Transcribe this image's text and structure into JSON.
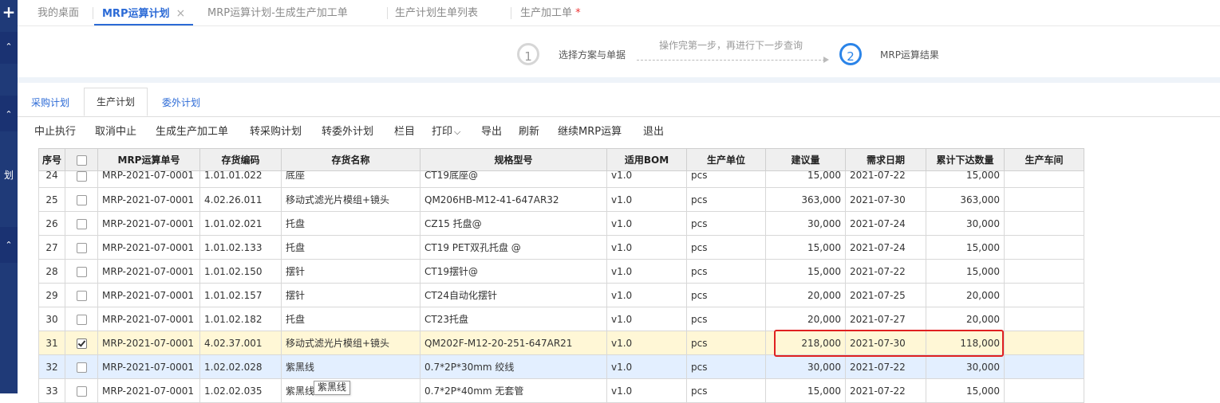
{
  "sidebar": {
    "label": "划"
  },
  "tabs": [
    {
      "label": "我的桌面",
      "active": false
    },
    {
      "label": "MRP运算计划",
      "active": true,
      "close": "×"
    },
    {
      "label": "MRP运算计划-生成生产加工单",
      "active": false
    },
    {
      "label": "生产计划生单列表",
      "active": false
    },
    {
      "label": "生产加工单",
      "active": false,
      "mark": "*"
    }
  ],
  "stepper": {
    "step1_num": "1",
    "step1_label": "选择方案与单据",
    "hint": "操作完第一步，再进行下一步查询",
    "step2_num": "2",
    "step2_label": "MRP运算结果"
  },
  "subtabs": [
    "采购计划",
    "生产计划",
    "委外计划"
  ],
  "toolbar": {
    "items": [
      "中止执行",
      "取消中止",
      "生成生产加工单",
      "转采购计划",
      "转委外计划",
      "栏目",
      "打印",
      "导出",
      "刷新",
      "继续MRP运算",
      "退出"
    ],
    "print_caret": "⌵"
  },
  "table": {
    "columns": [
      "序号",
      "",
      "MRP运算单号",
      "存货编码",
      "存货名称",
      "规格型号",
      "适用BOM",
      "生产单位",
      "建议量",
      "需求日期",
      "累计下达数量",
      "生产车间"
    ],
    "rows": [
      {
        "no": "24",
        "checked": false,
        "order": "MRP-2021-07-0001",
        "code": "1.01.01.022",
        "name": "底座",
        "spec": "CT19底座@",
        "bom": "v1.0",
        "unit": "pcs",
        "qty": "15,000",
        "date": "2021-07-22",
        "issued": "15,000",
        "workshop": ""
      },
      {
        "no": "25",
        "checked": false,
        "order": "MRP-2021-07-0001",
        "code": "4.02.26.011",
        "name": "移动式滤光片模组+镜头",
        "spec": "QM206HB-M12-41-647AR32",
        "bom": "v1.0",
        "unit": "pcs",
        "qty": "363,000",
        "date": "2021-07-30",
        "issued": "363,000",
        "workshop": ""
      },
      {
        "no": "26",
        "checked": false,
        "order": "MRP-2021-07-0001",
        "code": "1.01.02.021",
        "name": "托盘",
        "spec": "CZ15 托盘@",
        "bom": "v1.0",
        "unit": "pcs",
        "qty": "30,000",
        "date": "2021-07-24",
        "issued": "30,000",
        "workshop": ""
      },
      {
        "no": "27",
        "checked": false,
        "order": "MRP-2021-07-0001",
        "code": "1.01.02.133",
        "name": "托盘",
        "spec": "CT19 PET双孔托盘 @",
        "bom": "v1.0",
        "unit": "pcs",
        "qty": "15,000",
        "date": "2021-07-24",
        "issued": "15,000",
        "workshop": ""
      },
      {
        "no": "28",
        "checked": false,
        "order": "MRP-2021-07-0001",
        "code": "1.01.02.150",
        "name": "摆针",
        "spec": "CT19摆针@",
        "bom": "v1.0",
        "unit": "pcs",
        "qty": "15,000",
        "date": "2021-07-22",
        "issued": "15,000",
        "workshop": ""
      },
      {
        "no": "29",
        "checked": false,
        "order": "MRP-2021-07-0001",
        "code": "1.01.02.157",
        "name": "摆针",
        "spec": "CT24自动化摆针",
        "bom": "v1.0",
        "unit": "pcs",
        "qty": "20,000",
        "date": "2021-07-25",
        "issued": "20,000",
        "workshop": ""
      },
      {
        "no": "30",
        "checked": false,
        "order": "MRP-2021-07-0001",
        "code": "1.01.02.182",
        "name": "托盘",
        "spec": "CT23托盘",
        "bom": "v1.0",
        "unit": "pcs",
        "qty": "20,000",
        "date": "2021-07-27",
        "issued": "20,000",
        "workshop": ""
      },
      {
        "no": "31",
        "checked": true,
        "order": "MRP-2021-07-0001",
        "code": "4.02.37.001",
        "name": "移动式滤光片模组+镜头",
        "spec": "QM202F-M12-20-251-647AR21",
        "bom": "v1.0",
        "unit": "pcs",
        "qty": "218,000",
        "date": "2021-07-30",
        "issued": "118,000",
        "workshop": ""
      },
      {
        "no": "32",
        "checked": false,
        "order": "MRP-2021-07-0001",
        "code": "1.02.02.028",
        "name": "紫黑线",
        "spec": "0.7*2P*30mm 绞线",
        "bom": "v1.0",
        "unit": "pcs",
        "qty": "30,000",
        "date": "2021-07-22",
        "issued": "30,000",
        "workshop": ""
      },
      {
        "no": "33",
        "checked": false,
        "order": "MRP-2021-07-0001",
        "code": "1.02.02.035",
        "name": "紫黑线",
        "spec": "0.7*2P*40mm 无套管",
        "bom": "v1.0",
        "unit": "pcs",
        "qty": "15,000",
        "date": "2021-07-22",
        "issued": "15,000",
        "workshop": ""
      }
    ]
  },
  "tooltip": "紫黑线",
  "colors": {
    "accent": "#2b6ad6",
    "sidebar": "#1f3a78",
    "highlight_box": "#e02020",
    "selected_row": "#fff7d6",
    "hover_row": "#e3efff"
  }
}
